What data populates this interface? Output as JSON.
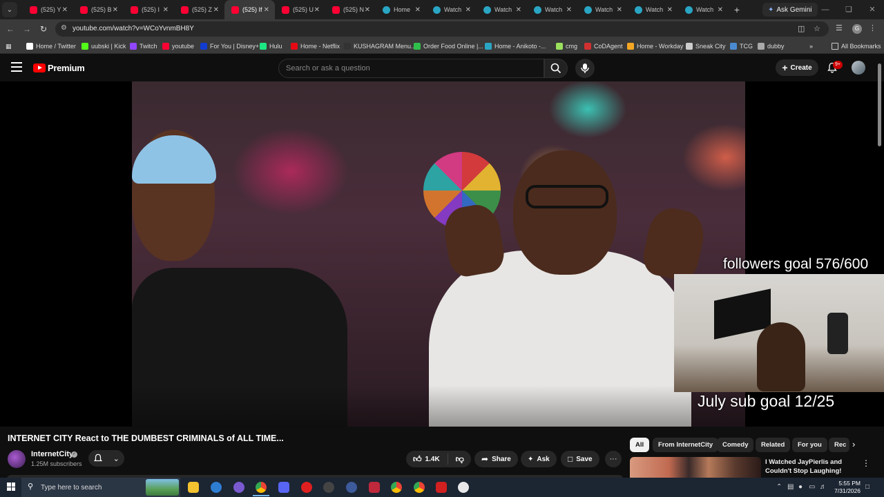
{
  "browser": {
    "tabs": [
      {
        "title": "(525) Y",
        "icon": "youtube-favicon"
      },
      {
        "title": "(525) B",
        "icon": "youtube-favicon"
      },
      {
        "title": "(525) I",
        "icon": "youtube-favicon"
      },
      {
        "title": "(525) Z",
        "icon": "youtube-favicon"
      },
      {
        "title": "(525) If",
        "icon": "youtube-favicon",
        "active": true
      },
      {
        "title": "(525) U",
        "icon": "youtube-favicon"
      },
      {
        "title": "(525) N",
        "icon": "youtube-favicon"
      },
      {
        "title": "Home",
        "icon": "anikoto-favicon"
      },
      {
        "title": "Watch",
        "icon": "anikoto-favicon"
      },
      {
        "title": "Watch",
        "icon": "anikoto-favicon"
      },
      {
        "title": "Watch",
        "icon": "anikoto-favicon"
      },
      {
        "title": "Watch",
        "icon": "anikoto-favicon"
      },
      {
        "title": "Watch",
        "icon": "anikoto-favicon"
      },
      {
        "title": "Watch",
        "icon": "anikoto-favicon"
      }
    ],
    "ask_gemini": "Ask Gemini",
    "url": "youtube.com/watch?v=WCoYvnmBH8Y",
    "profile_initial": "G",
    "bookmarks": [
      {
        "label": "Home / Twitter",
        "icon": "x-icon",
        "color": "#ffffff"
      },
      {
        "label": "uubski | Kick",
        "icon": "kick-icon",
        "color": "#53fc18"
      },
      {
        "label": "Twitch",
        "icon": "twitch-icon",
        "color": "#9146ff"
      },
      {
        "label": "youtube",
        "icon": "youtube-icon",
        "color": "#ff0033"
      },
      {
        "label": "For You | Disney+",
        "icon": "disney-icon",
        "color": "#113ccf"
      },
      {
        "label": "Hulu",
        "icon": "hulu-icon",
        "color": "#1ce783"
      },
      {
        "label": "Home - Netflix",
        "icon": "netflix-icon",
        "color": "#e50914"
      },
      {
        "label": "KUSHAGRAM Menu...",
        "icon": "leaf-icon",
        "color": "#333333"
      },
      {
        "label": "Order Food Online |...",
        "icon": "grubhub-icon",
        "color": "#2fbf4a"
      },
      {
        "label": "Home - Anikoto -...",
        "icon": "anikoto-icon",
        "color": "#2aa6c4"
      },
      {
        "label": "cmg",
        "icon": "cmg-icon",
        "color": "#9be15d"
      },
      {
        "label": "CoDAgent",
        "icon": "codagent-icon",
        "color": "#d03030"
      },
      {
        "label": "Home - Workday",
        "icon": "workday-icon",
        "color": "#f5a623"
      },
      {
        "label": "Sneak City",
        "icon": "globe-icon",
        "color": "#cccccc"
      },
      {
        "label": "TCG",
        "icon": "tcg-icon",
        "color": "#4a8ad0"
      },
      {
        "label": "dubby",
        "icon": "dubby-icon",
        "color": "#aaaaaa"
      }
    ],
    "all_bookmarks": "All Bookmarks"
  },
  "youtube": {
    "logo_text": "Premium",
    "search_placeholder": "Search or ask a question",
    "create_label": "Create",
    "notification_count": "9+"
  },
  "overlays": {
    "followers_goal": "followers goal 576/600",
    "sub_goal": "July sub goal 12/25"
  },
  "video": {
    "title": "INTERNET CITY React to THE DUMBEST CRIMINALS of ALL TIME...",
    "channel": "InternetCity",
    "subscribers": "1.25M subscribers",
    "likes": "1.4K",
    "share_label": "Share",
    "ask_label": "Ask",
    "save_label": "Save"
  },
  "chips": [
    "All",
    "From InternetCity",
    "Comedy",
    "Related",
    "For you",
    "Rec"
  ],
  "recommendation": {
    "title": "I Watched JayPierlis and Couldn't Stop Laughing!"
  },
  "taskbar": {
    "search_placeholder": "Type here to search",
    "time": "5:55 PM",
    "date": "7/31/2026"
  },
  "colors": {
    "youtube_red": "#ff0000",
    "background": "#0f0f0f",
    "taskbar": "#1c2532"
  }
}
